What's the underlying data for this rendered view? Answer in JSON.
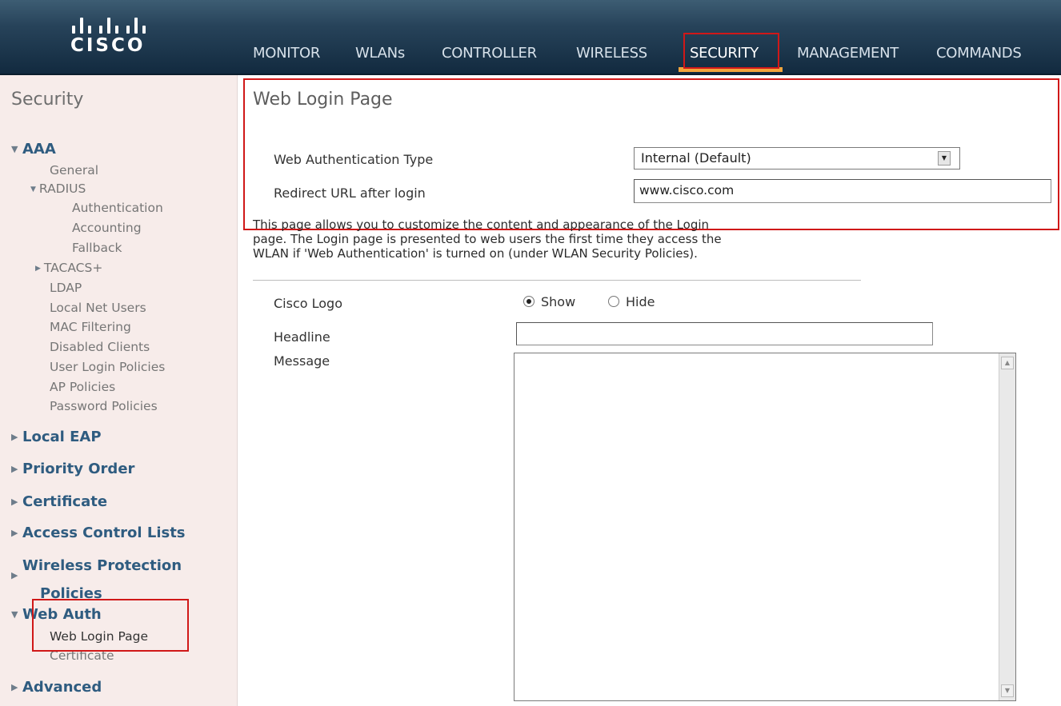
{
  "brand": {
    "name": "CISCO"
  },
  "nav": {
    "items": [
      {
        "label": "MONITOR"
      },
      {
        "label": "WLANs"
      },
      {
        "label": "CONTROLLER"
      },
      {
        "label": "WIRELESS"
      },
      {
        "label": "SECURITY"
      },
      {
        "label": "MANAGEMENT"
      },
      {
        "label": "COMMANDS"
      }
    ],
    "active": "SECURITY"
  },
  "sidebar": {
    "title": "Security",
    "aaa": {
      "label": "AAA",
      "general": "General",
      "radius": "RADIUS",
      "authentication": "Authentication",
      "accounting": "Accounting",
      "fallback": "Fallback",
      "tacacs": "TACACS+",
      "ldap": "LDAP",
      "local_net_users": "Local Net Users",
      "mac_filtering": "MAC Filtering",
      "disabled_clients": "Disabled Clients",
      "user_login_policies": "User Login Policies",
      "ap_policies": "AP Policies",
      "password_policies": "Password Policies"
    },
    "local_eap": "Local EAP",
    "priority_order": "Priority Order",
    "certificate": "Certificate",
    "access_control_lists": "Access Control Lists",
    "wireless_protection_1": "Wireless Protection",
    "wireless_protection_2": "Policies",
    "web_auth": {
      "label": "Web Auth",
      "web_login_page": "Web Login Page",
      "certificate": "Certificate"
    },
    "advanced": "Advanced"
  },
  "main": {
    "title": "Web Login Page",
    "auth_type_label": "Web Authentication Type",
    "auth_type_value": "Internal (Default)",
    "redirect_label": "Redirect URL after login",
    "redirect_value": "www.cisco.com",
    "description_1": "This page allows you to customize the content and appearance of the Login",
    "description_2": "page. The Login page is presented to web users the first time they access the",
    "description_3": "WLAN if 'Web Authentication' is turned on (under WLAN Security Policies).",
    "cisco_logo_label": "Cisco Logo",
    "show_label": "Show",
    "hide_label": "Hide",
    "cisco_logo_selected": "Show",
    "headline_label": "Headline",
    "headline_value": "",
    "message_label": "Message",
    "message_value": ""
  }
}
